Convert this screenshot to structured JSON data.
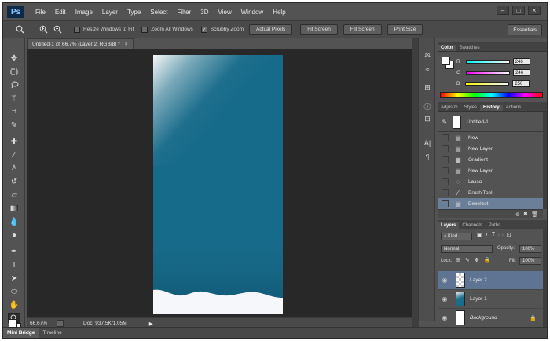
{
  "app": {
    "logo": "Ps",
    "menu": [
      "File",
      "Edit",
      "Image",
      "Layer",
      "Type",
      "Select",
      "Filter",
      "3D",
      "View",
      "Window",
      "Help"
    ],
    "window_controls": [
      "–",
      "□",
      "×"
    ]
  },
  "options_bar": {
    "resize_windows_label": "Resize Windows to Fit",
    "zoom_all_windows_label": "Zoom All Windows",
    "scrubby_zoom_label": "Scrubby Zoom",
    "scrubby_zoom_checked": true,
    "buttons": [
      "Actual Pixels",
      "Fit Screen",
      "Fill Screen",
      "Print Size"
    ],
    "workspace": "Essentials"
  },
  "document": {
    "tab_title": "Untitled-1 @ 66.7% (Layer 2, RGB/8) *",
    "tab_close": "×",
    "zoom": "66.67%",
    "doc_size": "Doc: 937.5K/1.05M",
    "canvas_color": "#176b8a"
  },
  "bottom_tabs": [
    "Mini Bridge",
    "Timeline"
  ],
  "color_panel": {
    "tabs": [
      "Color",
      "Swatches"
    ],
    "channels": [
      {
        "label": "R",
        "value": "246"
      },
      {
        "label": "G",
        "value": "246"
      },
      {
        "label": "B",
        "value": "250"
      }
    ]
  },
  "history_panel": {
    "tabs": [
      "Adjustm",
      "Styles",
      "History",
      "Actions"
    ],
    "snapshot": "Untitled-1",
    "items": [
      "New",
      "New Layer",
      "Gradient",
      "New Layer",
      "Lasso",
      "Brush Tool",
      "Deselect"
    ],
    "selected_index": 6
  },
  "layers_panel": {
    "tabs": [
      "Layers",
      "Channels",
      "Paths"
    ],
    "filter": "Kind",
    "blend_mode": "Normal",
    "opacity_label": "Opacity:",
    "opacity": "100%",
    "lock_label": "Lock:",
    "fill_label": "Fill:",
    "fill": "100%",
    "layers": [
      "Layer 2",
      "Layer 1",
      "Background"
    ],
    "selected_layer": "Layer 2"
  }
}
